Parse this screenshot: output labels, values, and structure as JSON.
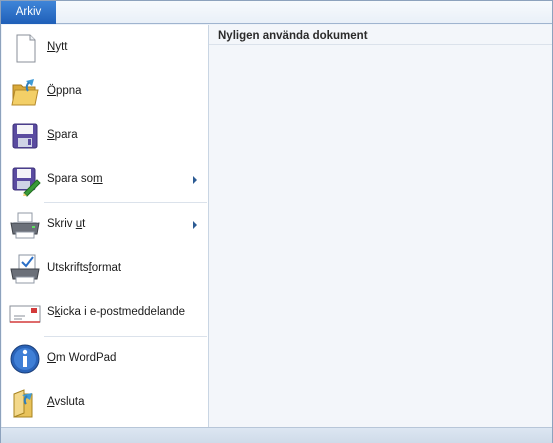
{
  "tab": {
    "label": "Arkiv"
  },
  "menu": {
    "items": [
      {
        "pre": "",
        "ul": "N",
        "post": "ytt",
        "icon": "new-document-icon"
      },
      {
        "pre": "",
        "ul": "Ö",
        "post": "ppna",
        "icon": "open-folder-icon"
      },
      {
        "pre": "",
        "ul": "S",
        "post": "para",
        "icon": "save-floppy-icon"
      },
      {
        "pre": "Spara so",
        "ul": "m",
        "post": "",
        "icon": "save-as-icon"
      },
      {
        "pre": "Skriv ",
        "ul": "u",
        "post": "t",
        "icon": "printer-icon"
      },
      {
        "pre": "Utskrifts",
        "ul": "f",
        "post": "ormat",
        "icon": "page-setup-icon"
      },
      {
        "pre": "S",
        "ul": "k",
        "post": "icka i e-postmeddelande",
        "icon": "email-icon"
      },
      {
        "pre": "",
        "ul": "O",
        "post": "m WordPad",
        "icon": "info-icon"
      },
      {
        "pre": "",
        "ul": "A",
        "post": "vsluta",
        "icon": "exit-icon"
      }
    ]
  },
  "recent": {
    "title": "Nyligen använda dokument"
  }
}
